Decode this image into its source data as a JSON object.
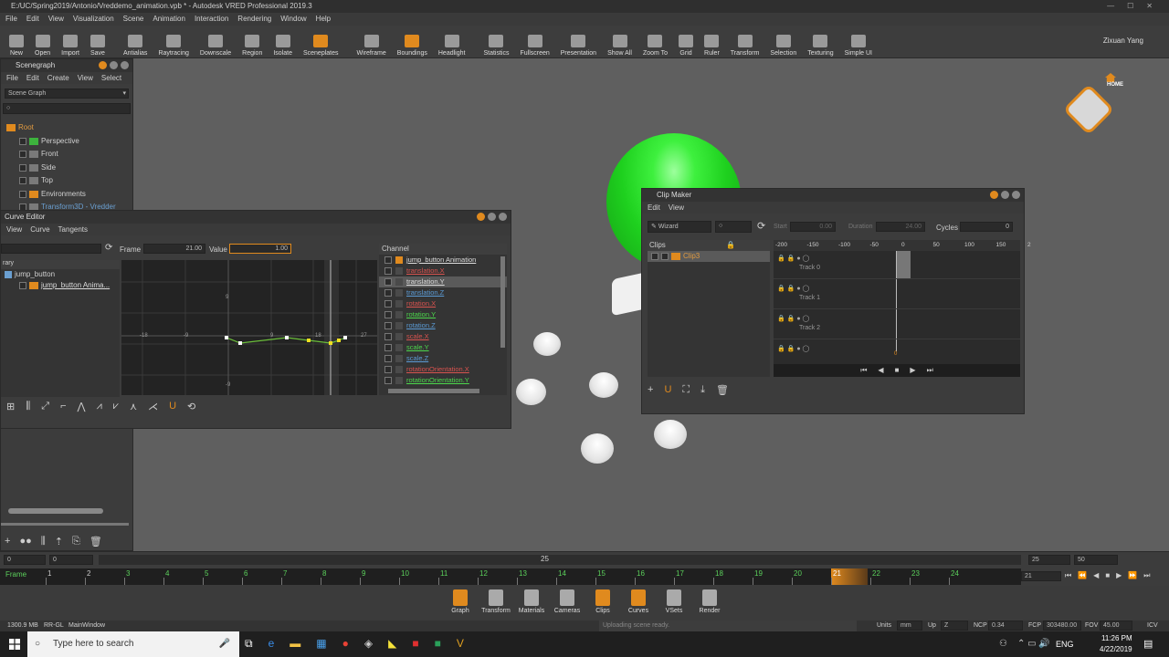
{
  "window": {
    "title": "E:/UC/Spring2019/Antonio/Vreddemo_animation.vpb * - Autodesk VRED Professional 2019.3"
  },
  "menubar": [
    "File",
    "Edit",
    "View",
    "Visualization",
    "Scene",
    "Animation",
    "Interaction",
    "Rendering",
    "Window",
    "Help"
  ],
  "toolbar": [
    {
      "label": "New",
      "icon": "new-file-icon"
    },
    {
      "label": "Open",
      "icon": "folder-icon"
    },
    {
      "label": "Import",
      "icon": "import-icon"
    },
    {
      "label": "Save",
      "icon": "save-icon"
    },
    {
      "label": "Antialias",
      "icon": "antialias-icon"
    },
    {
      "label": "Raytracing",
      "icon": "raytracing-icon"
    },
    {
      "label": "Downscale",
      "icon": "downscale-icon"
    },
    {
      "label": "Region",
      "icon": "region-icon"
    },
    {
      "label": "Isolate",
      "icon": "isolate-icon"
    },
    {
      "label": "Sceneplates",
      "icon": "sceneplates-icon"
    },
    {
      "label": "Wireframe",
      "icon": "wireframe-icon"
    },
    {
      "label": "Boundings",
      "icon": "boundings-icon"
    },
    {
      "label": "Headlight",
      "icon": "headlight-icon"
    },
    {
      "label": "Statistics",
      "icon": "statistics-icon"
    },
    {
      "label": "Fullscreen",
      "icon": "fullscreen-icon"
    },
    {
      "label": "Presentation",
      "icon": "presentation-icon"
    },
    {
      "label": "Show All",
      "icon": "show-all-icon"
    },
    {
      "label": "Zoom To",
      "icon": "zoom-to-icon"
    },
    {
      "label": "Grid",
      "icon": "grid-icon"
    },
    {
      "label": "Ruler",
      "icon": "ruler-icon"
    },
    {
      "label": "Transform",
      "icon": "transform-icon"
    },
    {
      "label": "Selection",
      "icon": "selection-icon"
    },
    {
      "label": "Texturing",
      "icon": "texturing-icon"
    },
    {
      "label": "Simple UI",
      "icon": "simple-ui-icon"
    }
  ],
  "user": {
    "name": "Zixuan Yang"
  },
  "viewcube": {
    "label": "HOME"
  },
  "scenegraph": {
    "title": "Scenegraph",
    "menu": [
      "File",
      "Edit",
      "Create",
      "View",
      "Select"
    ],
    "dropdown": "Scene Graph",
    "items": [
      "Root",
      "Perspective",
      "Front",
      "Side",
      "Top",
      "Environments",
      "Transform3D - Vredder"
    ]
  },
  "curve_editor": {
    "title": "Curve Editor",
    "menu": [
      "View",
      "Curve",
      "Tangents"
    ],
    "frame_label": "Frame",
    "frame_value": "21.00",
    "value_label": "Value",
    "value_value": "1.00",
    "library_label": "rary",
    "library_items": [
      "jump_button",
      "jump_button Anima..."
    ],
    "graph_labels": {
      "top": "9",
      "left": "-18",
      "midleft": "-9",
      "mid": "9",
      "right1": "18",
      "right2": "27",
      "bottom": "-9"
    },
    "channel_header": "Channel",
    "channels": [
      {
        "name": "jump_button Animation",
        "color": "cy"
      },
      {
        "name": "translation.X",
        "color": "cr"
      },
      {
        "name": "translation.Y",
        "color": "cy"
      },
      {
        "name": "translation.Z",
        "color": "cb"
      },
      {
        "name": "rotation.X",
        "color": "cr"
      },
      {
        "name": "rotation.Y",
        "color": "cg"
      },
      {
        "name": "rotation.Z",
        "color": "cb"
      },
      {
        "name": "scale.X",
        "color": "cr"
      },
      {
        "name": "scale.Y",
        "color": "cg"
      },
      {
        "name": "scale.Z",
        "color": "cb"
      },
      {
        "name": "rotationOrientation.X",
        "color": "cr"
      },
      {
        "name": "rotationOrientation.Y",
        "color": "cg"
      }
    ]
  },
  "clip_maker": {
    "title": "Clip Maker",
    "menu": [
      "Edit",
      "View"
    ],
    "wizard": "Wizard",
    "start_label": "Start",
    "start_value": "0.00",
    "duration_label": "Duration",
    "duration_value": "24.00",
    "cycles_label": "Cycles",
    "cycles_value": "0",
    "clips_header": "Clips",
    "clip": "Clip3",
    "ruler": [
      "-200",
      "-150",
      "-100",
      "-50",
      "0",
      "50",
      "100",
      "150",
      "2"
    ],
    "tracks": [
      "Track 0",
      "Track 1",
      "Track 2"
    ],
    "cursor_label": "0"
  },
  "timeline": {
    "start": "0",
    "end_field": "0",
    "mid_value": "25",
    "range_start": "25",
    "range_end": "50",
    "frame_label": "Frame",
    "ticks": [
      "1",
      "2",
      "3",
      "4",
      "5",
      "6",
      "7",
      "8",
      "9",
      "10",
      "11",
      "12",
      "13",
      "14",
      "15",
      "16",
      "17",
      "18",
      "19",
      "20",
      "21",
      "22",
      "23",
      "24"
    ],
    "current": "21",
    "current_field": "21"
  },
  "modules": [
    {
      "label": "Graph",
      "icon": "graph-icon"
    },
    {
      "label": "Transform",
      "icon": "transform-module-icon"
    },
    {
      "label": "Materials",
      "icon": "materials-icon"
    },
    {
      "label": "Cameras",
      "icon": "cameras-icon"
    },
    {
      "label": "Clips",
      "icon": "clips-icon"
    },
    {
      "label": "Curves",
      "icon": "curves-icon"
    },
    {
      "label": "VSets",
      "icon": "vsets-icon"
    },
    {
      "label": "Render",
      "icon": "render-icon"
    }
  ],
  "statusbar": {
    "memory": "1300.9 MB",
    "renderer": "RR-GL",
    "window": "MainWindow",
    "message": "Uploading scene ready.",
    "units_label": "Units",
    "units": "mm",
    "up_label": "Up",
    "up": "Z",
    "ncp_label": "NCP",
    "ncp": "0.34",
    "fcp_label": "FCP",
    "fcp": "303480.00",
    "fov_label": "FOV",
    "fov": "45.00",
    "icv": "ICV"
  },
  "taskbar": {
    "search_placeholder": "Type here to search",
    "lang": "ENG",
    "time": "11:26 PM",
    "date": "4/22/2019"
  }
}
